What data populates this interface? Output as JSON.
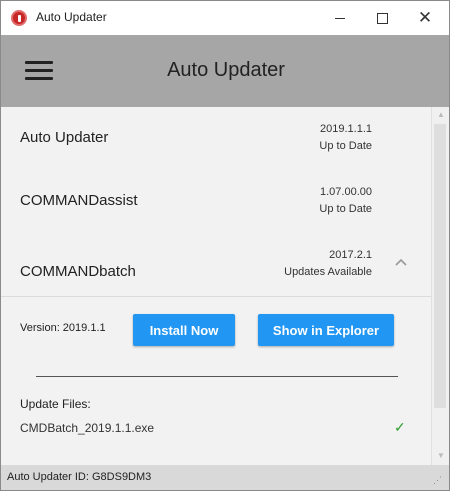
{
  "window": {
    "title": "Auto Updater"
  },
  "header": {
    "title": "Auto Updater"
  },
  "apps": [
    {
      "name": "Auto Updater",
      "version": "2019.1.1.1",
      "status": "Up to Date"
    },
    {
      "name": "COMMANDassist",
      "version": "1.07.00.00",
      "status": "Up to Date"
    },
    {
      "name": "COMMANDbatch",
      "version": "2017.2.1",
      "status": "Updates Available",
      "expanded": true
    }
  ],
  "details": {
    "version_label": "Version: 2019.1.1",
    "install_label": "Install Now",
    "explorer_label": "Show in Explorer",
    "update_files_label": "Update Files:",
    "files": [
      {
        "name": "CMDBatch_2019.1.1.exe",
        "checked": true
      }
    ]
  },
  "status_bar": {
    "text": "Auto Updater ID: G8DS9DM3"
  },
  "colors": {
    "accent": "#2196f3",
    "header_bg": "#a6a6a6",
    "check": "#2e9e2e",
    "app_icon": "#c62828"
  }
}
